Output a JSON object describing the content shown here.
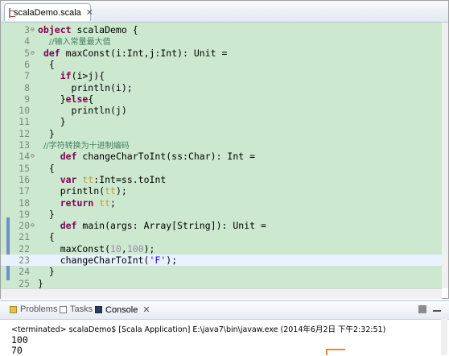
{
  "editor": {
    "tab_label": "scalaDemo.scala",
    "close_glyph": "✕"
  },
  "code_lines": [
    {
      "n": "3",
      "fold": "⊖",
      "tokens": [
        [
          "kw",
          "object"
        ],
        [
          "t",
          " scalaDemo {"
        ]
      ]
    },
    {
      "n": "4",
      "fold": "",
      "tokens": [
        [
          "t",
          "  "
        ],
        [
          "cm",
          "//输入常量最大值"
        ]
      ]
    },
    {
      "n": "5",
      "fold": "⊖",
      "tokens": [
        [
          "t",
          " "
        ],
        [
          "kw",
          "def"
        ],
        [
          "t",
          " maxConst(i:Int,j:Int): Unit ="
        ]
      ]
    },
    {
      "n": "6",
      "fold": "",
      "tokens": [
        [
          "t",
          "  {"
        ]
      ]
    },
    {
      "n": "7",
      "fold": "",
      "tokens": [
        [
          "t",
          "    "
        ],
        [
          "kw",
          "if"
        ],
        [
          "t",
          "(i>j){"
        ]
      ]
    },
    {
      "n": "8",
      "fold": "",
      "tokens": [
        [
          "t",
          "      println(i);"
        ]
      ]
    },
    {
      "n": "9",
      "fold": "",
      "tokens": [
        [
          "t",
          "    }"
        ],
        [
          "kw",
          "else"
        ],
        [
          "t",
          "{"
        ]
      ]
    },
    {
      "n": "10",
      "fold": "",
      "tokens": [
        [
          "t",
          "      println(j)"
        ]
      ]
    },
    {
      "n": "11",
      "fold": "",
      "tokens": [
        [
          "t",
          "    }"
        ]
      ]
    },
    {
      "n": "12",
      "fold": "",
      "tokens": [
        [
          "t",
          "  }"
        ]
      ]
    },
    {
      "n": "13",
      "fold": "",
      "tokens": [
        [
          "t",
          " "
        ],
        [
          "cm",
          "//字符转换为十进制编码"
        ]
      ]
    },
    {
      "n": "14",
      "fold": "⊖",
      "tokens": [
        [
          "t",
          "    "
        ],
        [
          "kw",
          "def"
        ],
        [
          "t",
          " changeCharToInt(ss:Char): Int ="
        ]
      ]
    },
    {
      "n": "15",
      "fold": "",
      "tokens": [
        [
          "t",
          "  {"
        ]
      ]
    },
    {
      "n": "16",
      "fold": "",
      "tokens": [
        [
          "t",
          "    "
        ],
        [
          "kw",
          "var"
        ],
        [
          "t",
          " "
        ],
        [
          "var",
          "tt"
        ],
        [
          "t",
          ":Int=ss.toInt"
        ]
      ]
    },
    {
      "n": "17",
      "fold": "",
      "tokens": [
        [
          "t",
          "    println("
        ],
        [
          "var",
          "tt"
        ],
        [
          "t",
          ");"
        ]
      ]
    },
    {
      "n": "18",
      "fold": "",
      "tokens": [
        [
          "t",
          "    "
        ],
        [
          "kw",
          "return"
        ],
        [
          "t",
          " "
        ],
        [
          "var",
          "tt"
        ],
        [
          "t",
          ";"
        ]
      ]
    },
    {
      "n": "19",
      "fold": "",
      "tokens": [
        [
          "t",
          "  }"
        ]
      ]
    },
    {
      "n": "20",
      "fold": "⊖",
      "tokens": [
        [
          "t",
          "    "
        ],
        [
          "kw",
          "def"
        ],
        [
          "t",
          " main(args: Array[String]): Unit ="
        ]
      ]
    },
    {
      "n": "21",
      "fold": "",
      "tokens": [
        [
          "t",
          "  {"
        ]
      ]
    },
    {
      "n": "22",
      "fold": "",
      "tokens": [
        [
          "t",
          "    maxConst("
        ],
        [
          "num",
          "10"
        ],
        [
          "t",
          ","
        ],
        [
          "num",
          "100"
        ],
        [
          "t",
          ");"
        ]
      ]
    },
    {
      "n": "23",
      "fold": "",
      "tokens": [
        [
          "t",
          "    changeCharToInt("
        ],
        [
          "str",
          "'F'"
        ],
        [
          "t",
          ");"
        ]
      ],
      "current": true
    },
    {
      "n": "24",
      "fold": "",
      "tokens": [
        [
          "t",
          "  }"
        ]
      ]
    },
    {
      "n": "25",
      "fold": "",
      "tokens": [
        [
          "t",
          "}"
        ]
      ]
    }
  ],
  "console": {
    "tabs": [
      {
        "label": "Problems",
        "icon": "problems-icon"
      },
      {
        "label": "Tasks",
        "icon": "tasks-icon"
      },
      {
        "label": "Console",
        "icon": "console-icon",
        "active": true
      }
    ],
    "status": "<terminated> scalaDemo$ [Scala Application] E:\\java7\\bin\\javaw.exe (2014年6月2日 下午2:32:51)",
    "output": [
      "100",
      "70"
    ],
    "close_glyph": "✕"
  },
  "colors": {
    "code_background": "#cce8cf",
    "current_line": "#e8f2fe",
    "keyword": "#7f0055",
    "comment": "#3f7f5f",
    "string": "#2a00ff"
  }
}
